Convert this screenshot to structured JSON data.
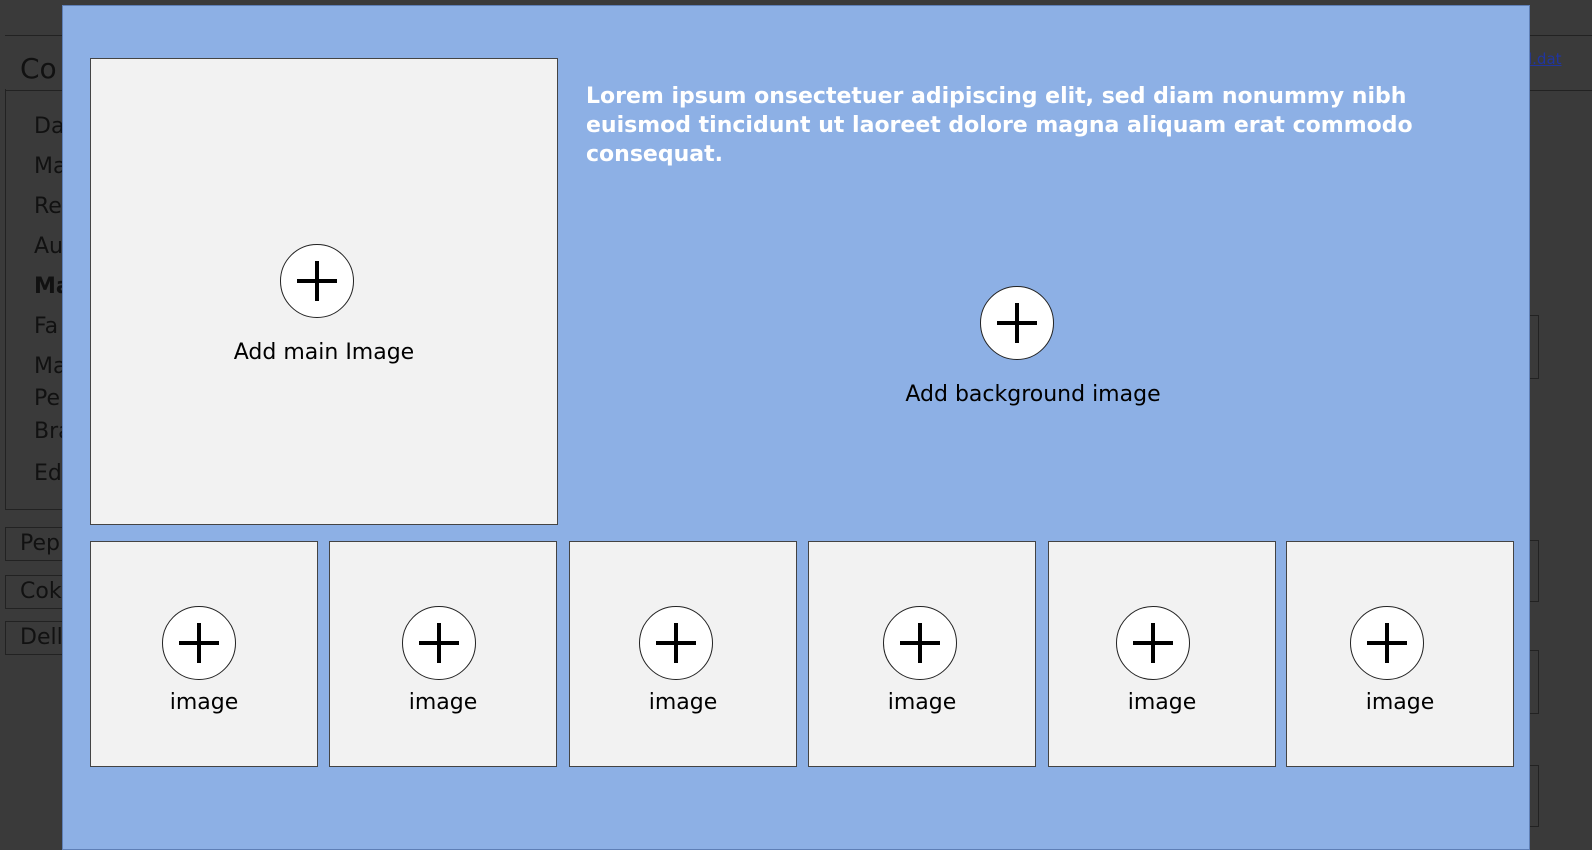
{
  "background_app": {
    "title": "Co",
    "nav_items": [
      "Da",
      "Ma",
      "Re",
      "Au",
      "Ma",
      "Fa",
      "Ma",
      "Pe",
      "Bra",
      "Edi"
    ],
    "list_items": [
      "Pep",
      "Cok",
      "Dell"
    ],
    "link_text": "l.dat"
  },
  "modal": {
    "description": "Lorem ipsum onsectetuer adipiscing elit, sed diam nonummy nibh euismod tincidunt ut laoreet dolore magna aliquam erat commodo consequat.",
    "main_image": {
      "label": "Add main Image",
      "icon": "plus-icon"
    },
    "background_image": {
      "label": "Add background image",
      "icon": "plus-icon"
    },
    "images": [
      {
        "label": "image",
        "icon": "plus-icon"
      },
      {
        "label": "image",
        "icon": "plus-icon"
      },
      {
        "label": "image",
        "icon": "plus-icon"
      },
      {
        "label": "image",
        "icon": "plus-icon"
      },
      {
        "label": "image",
        "icon": "plus-icon"
      },
      {
        "label": "image",
        "icon": "plus-icon"
      }
    ],
    "colors": {
      "modal_bg": "#8db0e5",
      "tile_bg": "#f2f2f2",
      "text_light": "#ffffff"
    }
  }
}
